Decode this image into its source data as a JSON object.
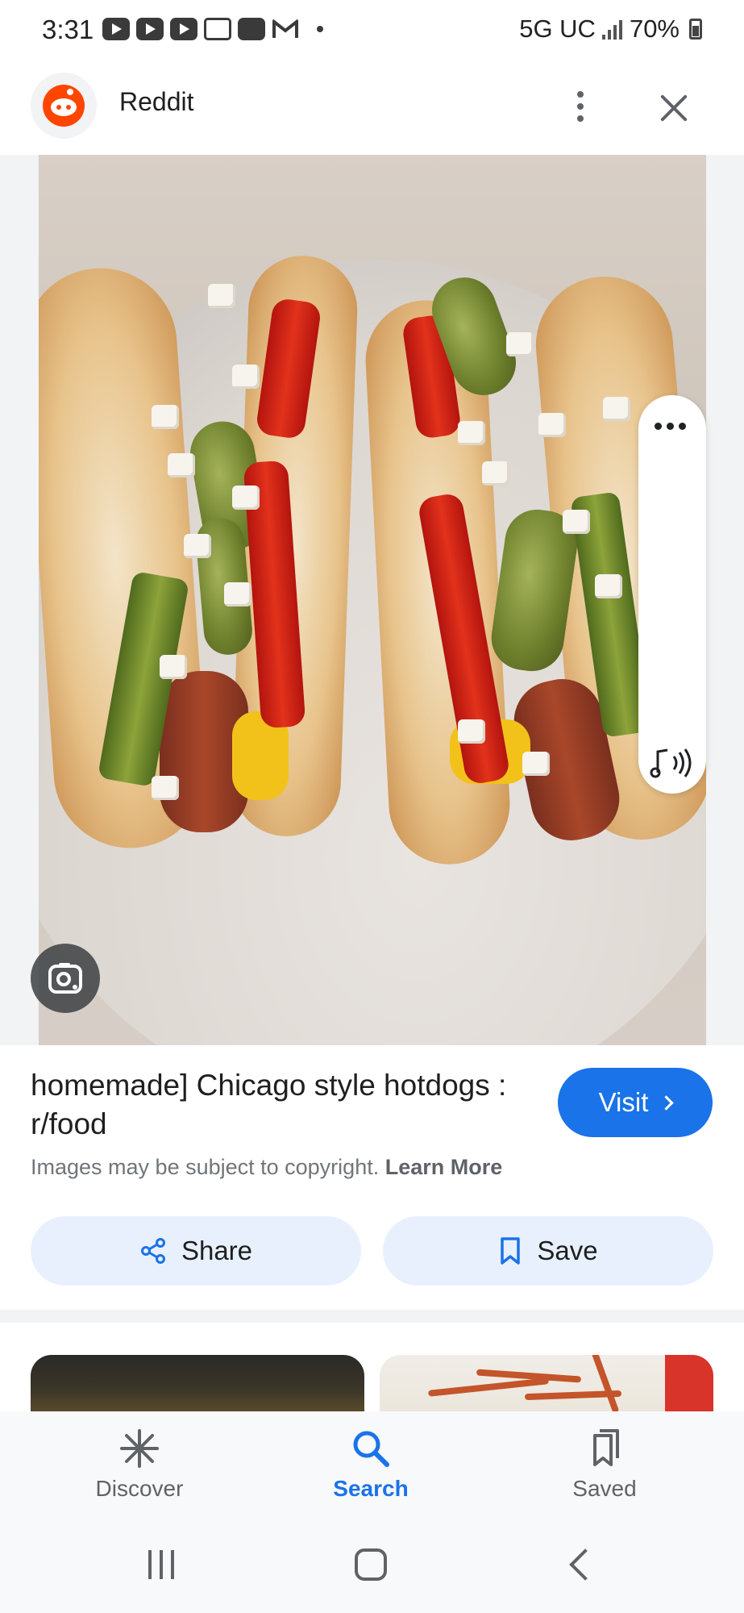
{
  "status_bar": {
    "time": "3:31",
    "network": "5G UC",
    "battery": "70%"
  },
  "app_bar": {
    "source_name": "Reddit"
  },
  "result": {
    "title": "homemade] Chicago style hotdogs : r/food",
    "visit_label": "Visit",
    "copyright_text": "Images may be subject to copyright.",
    "learn_more": "Learn More",
    "share_label": "Share",
    "save_label": "Save"
  },
  "bottom_nav": {
    "items": [
      {
        "label": "Discover",
        "icon": "asterisk-icon"
      },
      {
        "label": "Search",
        "icon": "search-icon"
      },
      {
        "label": "Saved",
        "icon": "bookmarks-icon"
      }
    ],
    "active": "Search"
  },
  "colors": {
    "accent": "#1a73e8",
    "button_tint": "#e8f0fe",
    "reddit": "#ff4500"
  }
}
